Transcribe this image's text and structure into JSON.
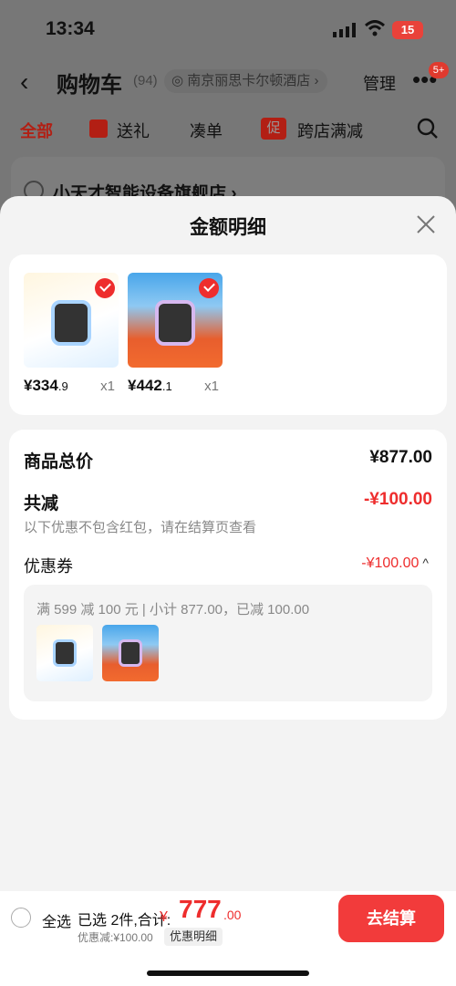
{
  "status": {
    "time": "13:34",
    "battery": "15"
  },
  "header": {
    "back_icon": "chevron-left-icon",
    "title": "购物车",
    "count": "(94)",
    "location": "南京丽思卡尔顿酒店",
    "location_chevron": "›",
    "manage": "管理",
    "more_icon": "•••",
    "more_badge": "5+"
  },
  "tabs": [
    {
      "label": "全部"
    },
    {
      "label": "送礼"
    },
    {
      "label": "凑单"
    },
    {
      "label": "跨店满减",
      "badge": "促"
    }
  ],
  "store_card": {
    "name": "小天才智能设备旗舰店",
    "chevron": "›"
  },
  "sheet": {
    "title": "金额明细",
    "products": [
      {
        "price_main": "¥334",
        "price_dec": ".9",
        "qty": "x1"
      },
      {
        "price_main": "¥442",
        "price_dec": ".1",
        "qty": "x1"
      }
    ],
    "summary": {
      "total_label": "商品总价",
      "total_value": "¥877.00",
      "discount_label": "共减",
      "discount_value": "-¥100.00",
      "note": "以下优惠不包含红包，请在结算页查看",
      "coupon_label": "优惠券",
      "coupon_value": "-¥100.00",
      "coupon_chevron": "^",
      "coupon_desc": "满 599 减 100 元 | 小计 877.00，已减 100.00"
    }
  },
  "bottom": {
    "select_all": "全选",
    "selected": "已选 2件,合计:",
    "currency": "¥",
    "total_int": "777",
    "total_dec": ".00",
    "discount_note": "优惠减:¥100.00",
    "detail_button": "优惠明细",
    "checkout": "去结算"
  },
  "colors": {
    "accent": "#ee2d2d",
    "checkout_bg": "#f23b3b"
  }
}
